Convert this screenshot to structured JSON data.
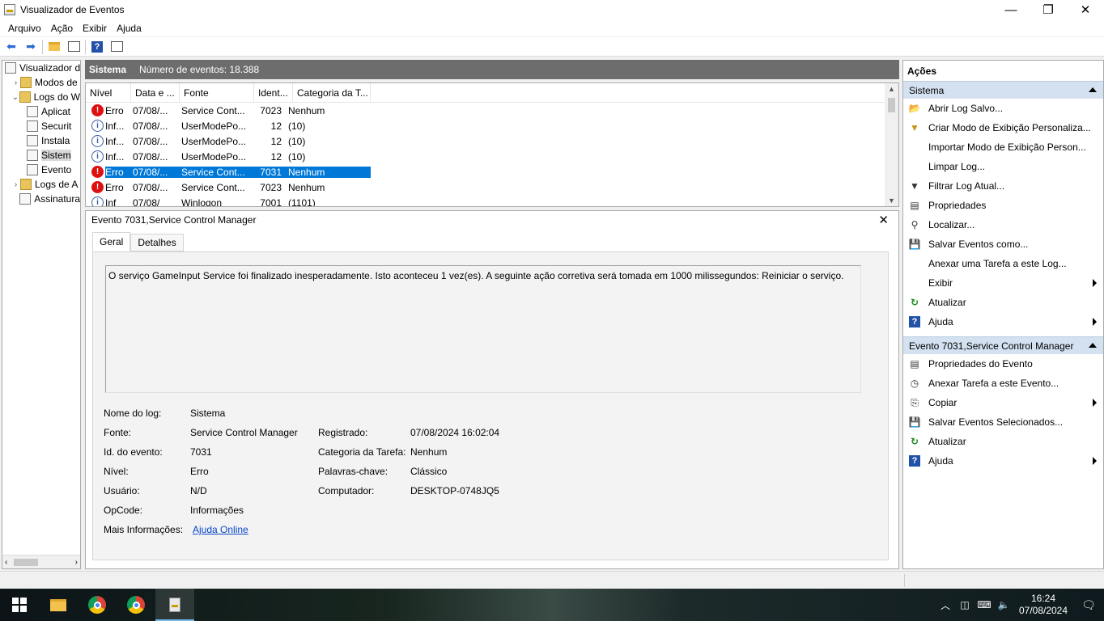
{
  "window": {
    "title": "Visualizador de Eventos",
    "min": "—",
    "max": "❐",
    "close": "✕"
  },
  "menu": [
    "Arquivo",
    "Ação",
    "Exibir",
    "Ajuda"
  ],
  "tree": [
    {
      "label": "Visualizador d",
      "expander": "",
      "indent": 0,
      "folder": false
    },
    {
      "label": "Modos de",
      "expander": "›",
      "indent": 1,
      "folder": true
    },
    {
      "label": "Logs do W",
      "expander": "⌄",
      "indent": 1,
      "folder": true
    },
    {
      "label": "Aplicat",
      "expander": "",
      "indent": 2,
      "folder": false
    },
    {
      "label": "Securit",
      "expander": "",
      "indent": 2,
      "folder": false
    },
    {
      "label": "Instala",
      "expander": "",
      "indent": 2,
      "folder": false
    },
    {
      "label": "Sistem",
      "expander": "",
      "indent": 2,
      "folder": false,
      "selected": true
    },
    {
      "label": "Evento",
      "expander": "",
      "indent": 2,
      "folder": false
    },
    {
      "label": "Logs de A",
      "expander": "›",
      "indent": 1,
      "folder": true
    },
    {
      "label": "Assinatura",
      "expander": "",
      "indent": 1,
      "folder": false
    }
  ],
  "tree_scroll": {
    "left": "‹",
    "right": "›"
  },
  "center": {
    "log_name": "Sistema",
    "count_label": "Número de eventos: 18.388"
  },
  "grid": {
    "columns": [
      "Nível",
      "Data e ...",
      "Fonte",
      "Ident...",
      "Categoria da T..."
    ],
    "rows": [
      {
        "level": "Erro",
        "type": "err",
        "date": "07/08/...",
        "source": "Service Cont...",
        "id": "7023",
        "category": "Nenhum"
      },
      {
        "level": "Inf...",
        "type": "info",
        "date": "07/08/...",
        "source": "UserModePo...",
        "id": "12",
        "category": "(10)"
      },
      {
        "level": "Inf...",
        "type": "info",
        "date": "07/08/...",
        "source": "UserModePo...",
        "id": "12",
        "category": "(10)"
      },
      {
        "level": "Inf...",
        "type": "info",
        "date": "07/08/...",
        "source": "UserModePo...",
        "id": "12",
        "category": "(10)"
      },
      {
        "level": "Erro",
        "type": "err",
        "date": "07/08/...",
        "source": "Service Cont...",
        "id": "7031",
        "category": "Nenhum",
        "selected": true
      },
      {
        "level": "Erro",
        "type": "err",
        "date": "07/08/...",
        "source": "Service Cont...",
        "id": "7023",
        "category": "Nenhum"
      },
      {
        "level": "Inf",
        "type": "info",
        "date": "07/08/",
        "source": "Winlogon",
        "id": "7001",
        "category": "(1101)"
      }
    ]
  },
  "detail": {
    "title": "Evento 7031,Service Control Manager",
    "tabs": [
      "Geral",
      "Detalhes"
    ],
    "description": "O serviço GameInput Service foi finalizado inesperadamente. Isto aconteceu 1 vez(es). A seguinte ação corretiva será tomada em 1000 milissegundos: Reiniciar o serviço.",
    "log_name_label": "Nome do log:",
    "log_name_value": "Sistema",
    "source_label": "Fonte:",
    "source_value": "Service Control Manager",
    "registered_label": "Registrado:",
    "registered_value": "07/08/2024 16:02:04",
    "event_id_label": "Id. do evento:",
    "event_id_value": "7031",
    "task_category_label": "Categoria da Tarefa:",
    "task_category_value": "Nenhum",
    "level_label": "Nível:",
    "level_value": "Erro",
    "keywords_label": "Palavras-chave:",
    "keywords_value": "Clássico",
    "user_label": "Usuário:",
    "user_value": "N/D",
    "computer_label": "Computador:",
    "computer_value": "DESKTOP-0748JQ5",
    "opcode_label": "OpCode:",
    "opcode_value": "Informações",
    "more_info_label": "Mais Informações:",
    "more_info_link": "Ajuda Online"
  },
  "actions": {
    "title": "Ações",
    "section1": "Sistema",
    "items1": [
      {
        "label": "Abrir Log Salvo...",
        "icon": "📂",
        "cls": "y",
        "name": "open-folder-icon"
      },
      {
        "label": "Criar Modo de Exibição Personaliza...",
        "icon": "▼",
        "cls": "y",
        "name": "filter-icon"
      },
      {
        "label": "Importar Modo de Exibição Person...",
        "icon": "",
        "cls": "",
        "name": "blank-icon"
      },
      {
        "label": "Limpar Log...",
        "icon": "",
        "cls": "",
        "name": "blank-icon"
      },
      {
        "label": "Filtrar Log Atual...",
        "icon": "▼",
        "cls": "d",
        "name": "filter-icon"
      },
      {
        "label": "Propriedades",
        "icon": "▤",
        "cls": "d",
        "name": "properties-icon"
      },
      {
        "label": "Localizar...",
        "icon": "⚲",
        "cls": "d",
        "name": "binoculars-icon"
      },
      {
        "label": "Salvar Eventos como...",
        "icon": "💾",
        "cls": "d",
        "name": "save-icon"
      },
      {
        "label": "Anexar uma Tarefa a este Log...",
        "icon": "",
        "cls": "",
        "name": "blank-icon"
      },
      {
        "label": "Exibir",
        "icon": "",
        "cls": "",
        "name": "blank-icon",
        "submenu": true
      },
      {
        "label": "Atualizar",
        "icon": "↻",
        "cls": "g",
        "name": "refresh-icon"
      },
      {
        "label": "Ajuda",
        "icon": "?",
        "cls": "q",
        "name": "help-icon",
        "submenu": true
      }
    ],
    "section2": "Evento 7031,Service Control Manager",
    "items2": [
      {
        "label": "Propriedades do Evento",
        "icon": "▤",
        "cls": "d",
        "name": "properties-icon"
      },
      {
        "label": "Anexar Tarefa a este Evento...",
        "icon": "◷",
        "cls": "d",
        "name": "task-icon"
      },
      {
        "label": "Copiar",
        "icon": "⎘",
        "cls": "d",
        "name": "copy-icon",
        "submenu": true
      },
      {
        "label": "Salvar Eventos Selecionados...",
        "icon": "💾",
        "cls": "d",
        "name": "save-icon"
      },
      {
        "label": "Atualizar",
        "icon": "↻",
        "cls": "g",
        "name": "refresh-icon"
      },
      {
        "label": "Ajuda",
        "icon": "?",
        "cls": "q",
        "name": "help-icon",
        "submenu": true
      }
    ]
  },
  "taskbar": {
    "time": "16:24",
    "date": "07/08/2024"
  }
}
